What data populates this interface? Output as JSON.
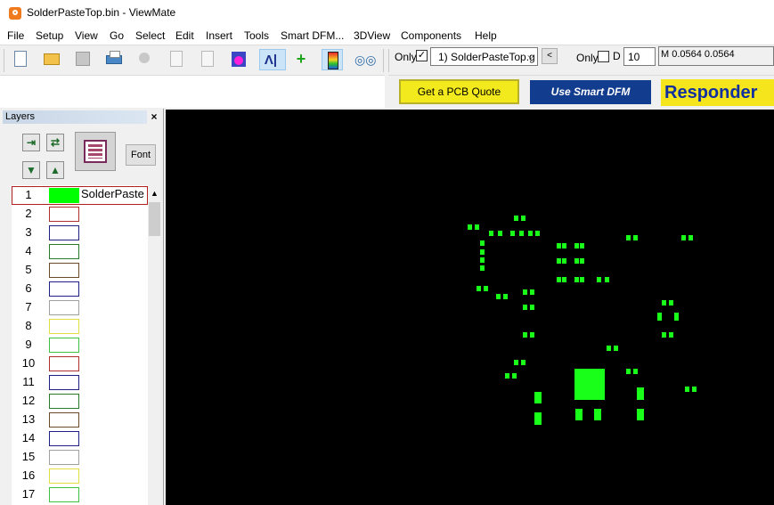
{
  "window": {
    "title": "SolderPasteTop.bin - ViewMate"
  },
  "menu": [
    "File",
    "Setup",
    "View",
    "Go",
    "Select",
    "Edit",
    "Insert",
    "Tools",
    "Smart DFM...",
    "3DView",
    "Components",
    "Help"
  ],
  "toolbar": {
    "only_label": "Only",
    "only_checked": true,
    "layer_selected": "1) SolderPasteTop.g",
    "only2_label": "Only",
    "only2_checked": false,
    "d_label": "D",
    "d_value": "10",
    "coord_readout": "M 0.0564  0.0564",
    "icons": [
      "new-file-icon",
      "open-folder-icon",
      "save-icon",
      "print-icon",
      "cut-icon",
      "copy-icon",
      "paste-icon",
      "pin-icon",
      "layers-icon",
      "add-layer-icon",
      "color-scale-icon",
      "view-glasses-icon"
    ]
  },
  "ads": {
    "quote": "Get a PCB Quote",
    "dfm": "Use Smart DFM",
    "responder": "Responder"
  },
  "layers_panel": {
    "title": "Layers",
    "close": "×",
    "font_button": "Font",
    "rows": [
      {
        "num": "1",
        "color": "#00ff00",
        "name": "SolderPaste",
        "filled": true
      },
      {
        "num": "2",
        "color": "#b03030",
        "name": "",
        "filled": false
      },
      {
        "num": "3",
        "color": "#202080",
        "name": "",
        "filled": false
      },
      {
        "num": "4",
        "color": "#2a7a2a",
        "name": "",
        "filled": false
      },
      {
        "num": "5",
        "color": "#6a4a2a",
        "name": "",
        "filled": false
      },
      {
        "num": "6",
        "color": "#202080",
        "name": "",
        "filled": false
      },
      {
        "num": "7",
        "color": "#a0a0a0",
        "name": "",
        "filled": false
      },
      {
        "num": "8",
        "color": "#e0e040",
        "name": "",
        "filled": false
      },
      {
        "num": "9",
        "color": "#40c040",
        "name": "",
        "filled": false
      },
      {
        "num": "10",
        "color": "#b03030",
        "name": "",
        "filled": false
      },
      {
        "num": "11",
        "color": "#202080",
        "name": "",
        "filled": false
      },
      {
        "num": "12",
        "color": "#2a7a2a",
        "name": "",
        "filled": false
      },
      {
        "num": "13",
        "color": "#6a4a2a",
        "name": "",
        "filled": false
      },
      {
        "num": "14",
        "color": "#202080",
        "name": "",
        "filled": false
      },
      {
        "num": "15",
        "color": "#a0a0a0",
        "name": "",
        "filled": false
      },
      {
        "num": "16",
        "color": "#e0e040",
        "name": "",
        "filled": false
      },
      {
        "num": "17",
        "color": "#40c040",
        "name": "",
        "filled": false
      }
    ]
  },
  "canvas": {
    "background": "#000000",
    "pad_color": "#1aff1a"
  }
}
